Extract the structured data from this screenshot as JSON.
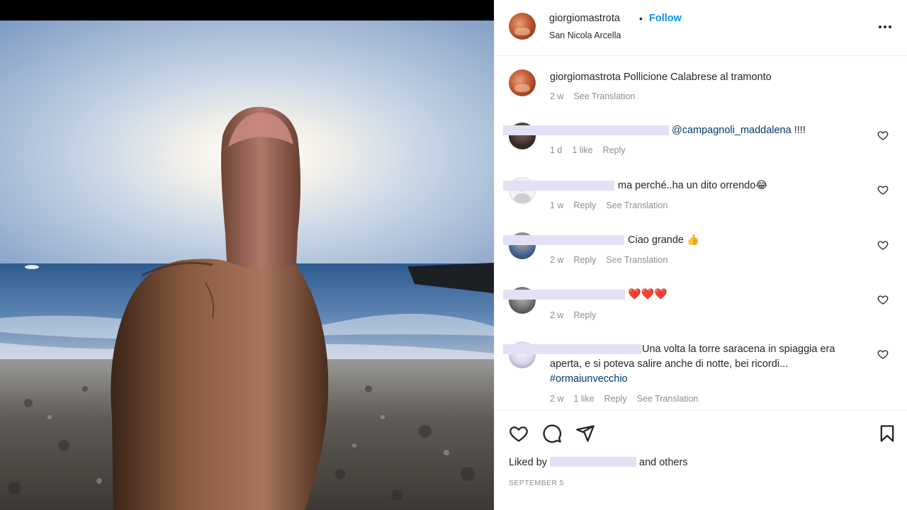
{
  "post": {
    "username": "giorgiomastrota",
    "follow_label": "Follow",
    "separator": "•",
    "location": "San Nicola Arcella",
    "caption": "Pollicione Calabrese al tramonto",
    "caption_age": "2 w",
    "see_translation": "See Translation"
  },
  "comments": [
    {
      "text": "@campagnoli_maddalena",
      "suffix": " !!!!",
      "age": "1 d",
      "likes": "1 like",
      "reply": "Reply"
    },
    {
      "text": "ma perché..ha un dito orrendo😂",
      "age": "1 w",
      "reply": "Reply",
      "translate": "See Translation"
    },
    {
      "text": "Ciao grande 👍",
      "age": "2 w",
      "reply": "Reply",
      "translate": "See Translation"
    },
    {
      "text": "❤️❤️❤️",
      "age": "2 w",
      "reply": "Reply"
    },
    {
      "text_line1": "Una volta la torre saracena in spiaggia era",
      "text_line2": "aperta, e si poteva salire anche di notte, bei ricordi...",
      "hashtag": "#ormaiunvecchio",
      "age": "2 w",
      "likes": "1 like",
      "reply": "Reply",
      "translate": "See Translation"
    }
  ],
  "footer": {
    "liked_by": "Liked by",
    "and_others": "and others",
    "date": "SEPTEMBER 5"
  },
  "icons": {
    "like": "heart-icon",
    "comment": "comment-icon",
    "share": "share-icon",
    "save": "bookmark-icon",
    "more": "more-options-icon"
  },
  "colors": {
    "follow": "#0095f6",
    "link": "#00376b",
    "muted": "#8e8e8e",
    "redaction": "#e3e1f5"
  }
}
